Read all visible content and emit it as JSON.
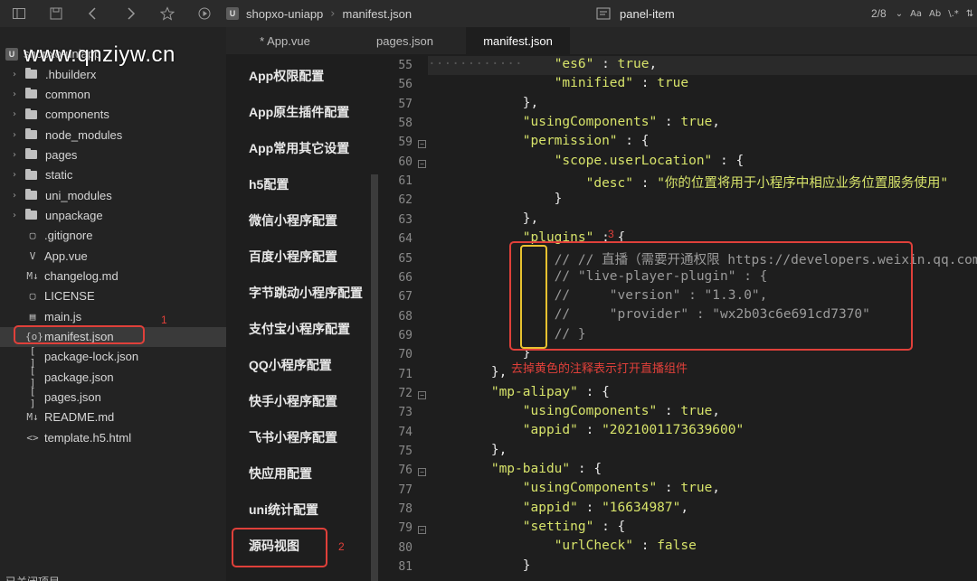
{
  "toolbar": {
    "icons": [
      "sidebar-icon",
      "save-icon",
      "back-icon",
      "forward-icon",
      "star-icon",
      "run-icon"
    ]
  },
  "breadcrumb": {
    "logo": "U",
    "project": "shopxo-uniapp",
    "file": "manifest.json"
  },
  "search": {
    "query": "panel-item",
    "count": "2/8",
    "tools": [
      "⌄",
      "Aa",
      "Ab",
      "\\.*",
      "⇅"
    ]
  },
  "tabs": [
    {
      "label": "* App.vue",
      "active": false
    },
    {
      "label": "pages.json",
      "active": false
    },
    {
      "label": "manifest.json",
      "active": true
    }
  ],
  "watermark": "www.qnziyw.cn",
  "tree": {
    "root": "shopxo-uniapp",
    "items": [
      {
        "label": ".hbuilderx",
        "type": "folder"
      },
      {
        "label": "common",
        "type": "folder"
      },
      {
        "label": "components",
        "type": "folder"
      },
      {
        "label": "node_modules",
        "type": "folder"
      },
      {
        "label": "pages",
        "type": "folder"
      },
      {
        "label": "static",
        "type": "folder"
      },
      {
        "label": "uni_modules",
        "type": "folder"
      },
      {
        "label": "unpackage",
        "type": "folder"
      },
      {
        "label": ".gitignore",
        "type": "file",
        "icon": "▢"
      },
      {
        "label": "App.vue",
        "type": "file",
        "icon": "V"
      },
      {
        "label": "changelog.md",
        "type": "file",
        "icon": "M↓"
      },
      {
        "label": "LICENSE",
        "type": "file",
        "icon": "▢"
      },
      {
        "label": "main.js",
        "type": "file",
        "icon": "▤"
      },
      {
        "label": "manifest.json",
        "type": "file",
        "icon": "{o}",
        "selected": true
      },
      {
        "label": "package-lock.json",
        "type": "file",
        "icon": "[ ]"
      },
      {
        "label": "package.json",
        "type": "file",
        "icon": "[ ]"
      },
      {
        "label": "pages.json",
        "type": "file",
        "icon": "[ ]"
      },
      {
        "label": "README.md",
        "type": "file",
        "icon": "M↓"
      },
      {
        "label": "template.h5.html",
        "type": "file",
        "icon": "<>"
      }
    ],
    "footer": "已关闭项目"
  },
  "config_menu": [
    "App权限配置",
    "App原生插件配置",
    "App常用其它设置",
    "h5配置",
    "微信小程序配置",
    "百度小程序配置",
    "字节跳动小程序配置",
    "支付宝小程序配置",
    "QQ小程序配置",
    "快手小程序配置",
    "飞书小程序配置",
    "快应用配置",
    "uni统计配置",
    "源码视图"
  ],
  "editor": {
    "line_numbers": [
      "55",
      "56",
      "57",
      "58",
      "59",
      "60",
      "61",
      "62",
      "63",
      "64",
      "65",
      "66",
      "67",
      "68",
      "69",
      "70",
      "71",
      "72",
      "73",
      "74",
      "75",
      "76",
      "77",
      "78",
      "79",
      "80",
      "81"
    ],
    "fold_lines": [
      "59",
      "60",
      "72",
      "76",
      "79"
    ]
  },
  "annotations": {
    "n1": "1",
    "n2": "2",
    "n3": "3",
    "note": "去掉黄色的注释表示打开直播组件"
  },
  "colors": {
    "string": "#d7e36a",
    "annotation": "#e0403a",
    "highlight": "#e8c230"
  }
}
